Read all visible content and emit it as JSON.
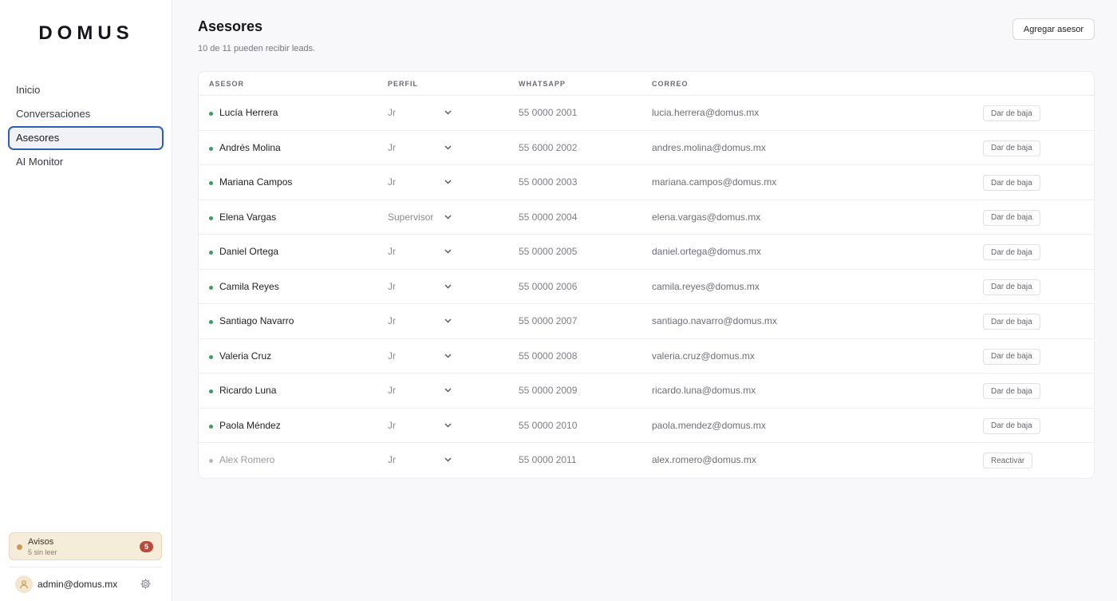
{
  "brand": {
    "logo": "DOMUS"
  },
  "nav": [
    {
      "label": "Inicio",
      "active": false
    },
    {
      "label": "Conversaciones",
      "active": false
    },
    {
      "label": "Asesores",
      "active": true
    },
    {
      "label": "AI Monitor",
      "active": false
    }
  ],
  "notice": {
    "title": "Avisos",
    "subtitle": "5 sin leer",
    "count": "5"
  },
  "user": {
    "email": "admin@domus.mx"
  },
  "page": {
    "title": "Asesores",
    "subtitle": "10 de 11 pueden recibir leads.",
    "add_button": "Agregar asesor"
  },
  "table": {
    "headers": [
      "ASESOR",
      "PERFIL",
      "WHATSAPP",
      "CORREO"
    ],
    "rows": [
      {
        "name": "Lucía Herrera",
        "profile": "Jr",
        "phone": "55 0000 2001",
        "email": "lucia.herrera@domus.mx",
        "action": "Dar de baja",
        "active": true
      },
      {
        "name": "Andrés Molina",
        "profile": "Jr",
        "phone": "55 6000 2002",
        "email": "andres.molina@domus.mx",
        "action": "Dar de baja",
        "active": true
      },
      {
        "name": "Mariana Campos",
        "profile": "Jr",
        "phone": "55 0000 2003",
        "email": "mariana.campos@domus.mx",
        "action": "Dar de baja",
        "active": true
      },
      {
        "name": "Elena Vargas",
        "profile": "Supervisor",
        "phone": "55 0000 2004",
        "email": "elena.vargas@domus.mx",
        "action": "Dar de baja",
        "active": true
      },
      {
        "name": "Daniel Ortega",
        "profile": "Jr",
        "phone": "55 0000 2005",
        "email": "daniel.ortega@domus.mx",
        "action": "Dar de baja",
        "active": true
      },
      {
        "name": "Camila Reyes",
        "profile": "Jr",
        "phone": "55 0000 2006",
        "email": "camila.reyes@domus.mx",
        "action": "Dar de baja",
        "active": true
      },
      {
        "name": "Santiago Navarro",
        "profile": "Jr",
        "phone": "55 0000 2007",
        "email": "santiago.navarro@domus.mx",
        "action": "Dar de baja",
        "active": true
      },
      {
        "name": "Valeria Cruz",
        "profile": "Jr",
        "phone": "55 0000 2008",
        "email": "valeria.cruz@domus.mx",
        "action": "Dar de baja",
        "active": true
      },
      {
        "name": "Ricardo Luna",
        "profile": "Jr",
        "phone": "55 0000 2009",
        "email": "ricardo.luna@domus.mx",
        "action": "Dar de baja",
        "active": true
      },
      {
        "name": "Paola Méndez",
        "profile": "Jr",
        "phone": "55 0000 2010",
        "email": "paola.mendez@domus.mx",
        "action": "Dar de baja",
        "active": true
      },
      {
        "name": "Alex Romero",
        "profile": "Jr",
        "phone": "55 0000 2011",
        "email": "alex.romero@domus.mx",
        "action": "Reactivar",
        "active": false
      }
    ]
  },
  "icons": {
    "status_dot": "status-dot-icon",
    "chevron": "chevron-down-icon",
    "avatar": "user-icon",
    "settings": "gear-icon"
  },
  "colors": {
    "active_status": "#3f9a62",
    "inactive_status": "#b8b8bf",
    "nav_active_border": "#2f5fb3",
    "notice_bg": "#f5ecd9",
    "badge": "#b94a3d"
  }
}
